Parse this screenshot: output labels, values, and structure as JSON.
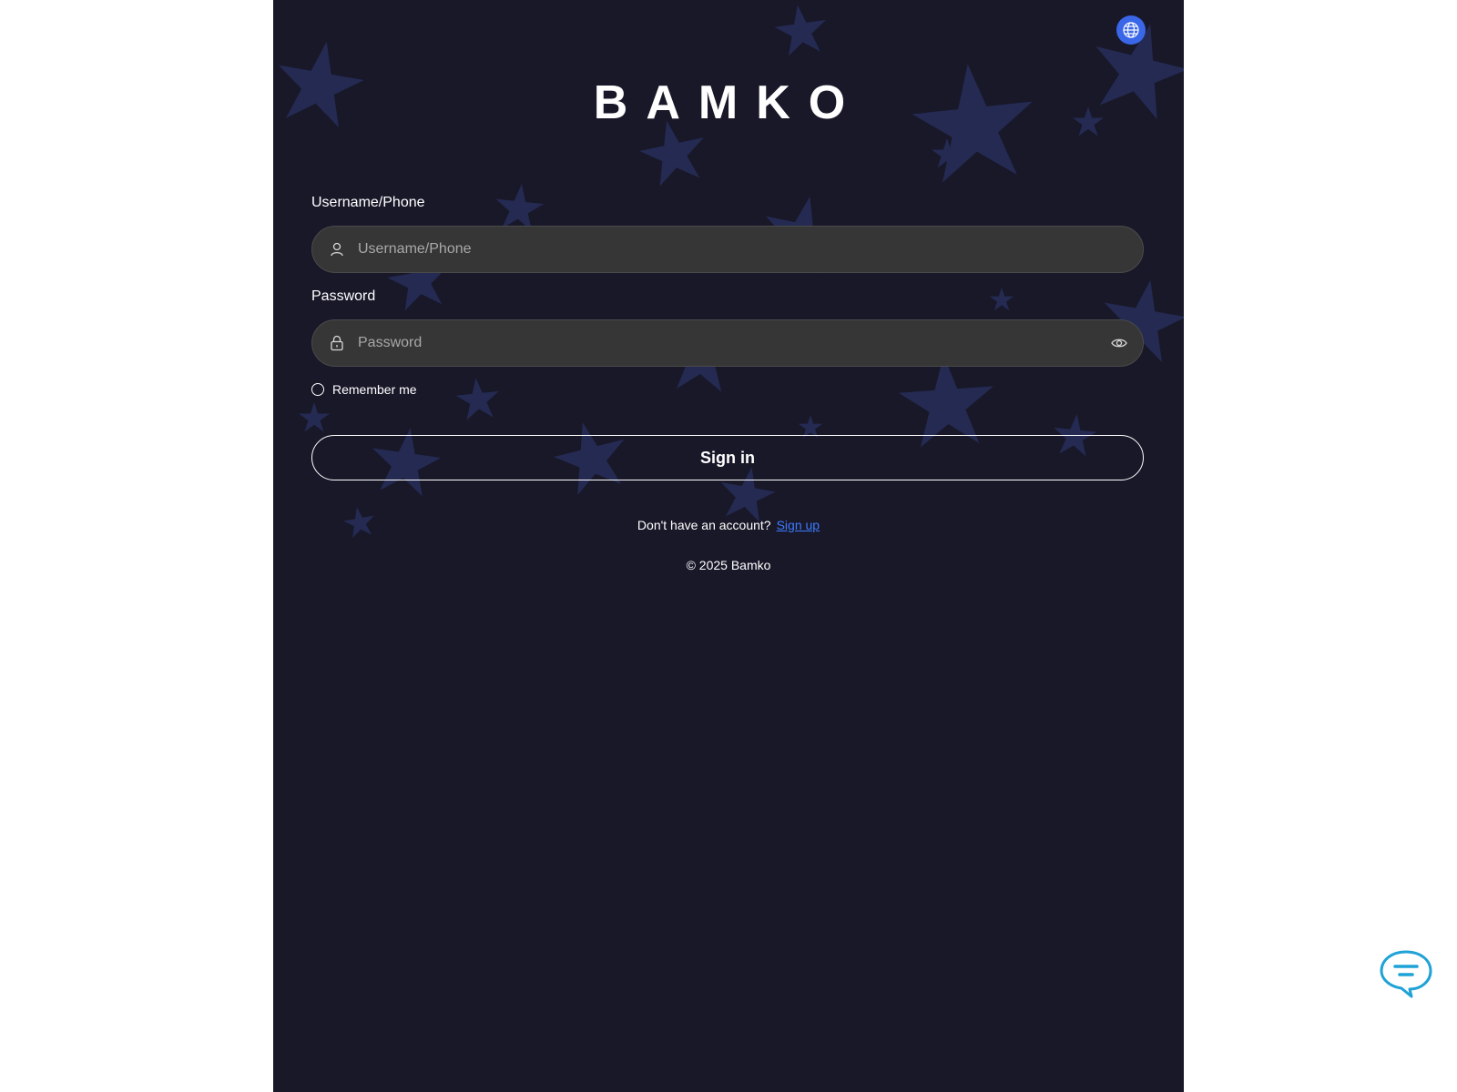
{
  "brand": {
    "name": "BAMKO"
  },
  "header": {
    "language_icon": "globe-icon",
    "language_button_color": "#3a66e8"
  },
  "form": {
    "username": {
      "label": "Username/Phone",
      "placeholder": "Username/Phone",
      "value": "",
      "icon": "user-icon"
    },
    "password": {
      "label": "Password",
      "placeholder": "Password",
      "value": "",
      "icon": "lock-icon",
      "toggle_icon": "eye-icon"
    },
    "remember_me": {
      "label": "Remember me",
      "checked": false
    },
    "submit_label": "Sign in"
  },
  "footer": {
    "signup_prompt": "Don't have an account?",
    "signup_link": "Sign up",
    "copyright": "© 2025 Bamko"
  },
  "chat": {
    "icon": "chat-bubble-icon",
    "color": "#1fa2d6"
  },
  "theme": {
    "background": "#191829",
    "input_background": "#363636",
    "link_color": "#3c7bff"
  }
}
